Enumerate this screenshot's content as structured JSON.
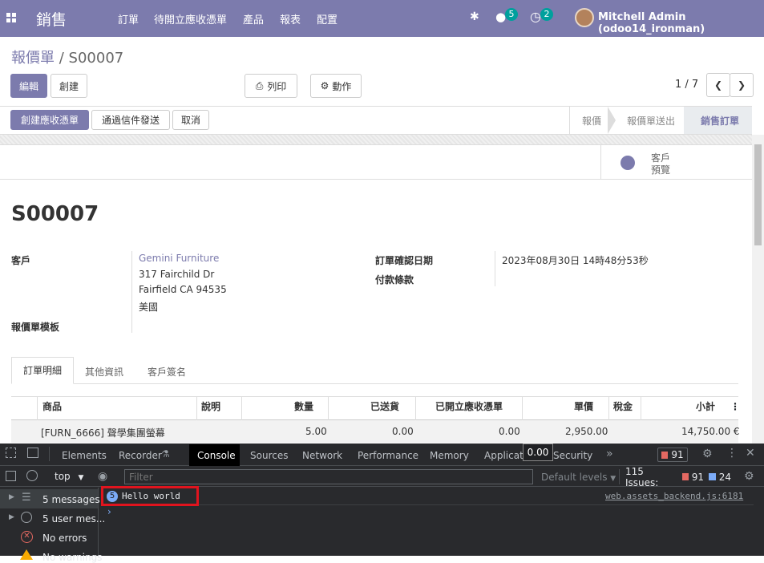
{
  "navbar": {
    "app": "銷售",
    "menu": [
      "訂單",
      "待開立應收憑單",
      "產品",
      "報表",
      "配置"
    ],
    "chat_count": "5",
    "activity_count": "2",
    "user": "Mitchell Admin (odoo14_ironman)"
  },
  "breadcrumb": {
    "parent": "報價單",
    "sep": "/",
    "current": "S00007"
  },
  "control": {
    "edit": "編輯",
    "create": "創建",
    "print": "列印",
    "action": "動作",
    "pager": "1 / 7"
  },
  "actions": {
    "invoice": "創建應收憑單",
    "email": "通過信件發送",
    "cancel": "取消"
  },
  "statusbar": [
    "報價",
    "報價單送出",
    "銷售訂單"
  ],
  "smart": {
    "line1": "客戶",
    "line2": "預覽"
  },
  "record": {
    "name": "S00007",
    "customer_label": "客戶",
    "customer_name": "Gemini Furniture",
    "addr1": "317 Fairchild Dr",
    "addr2": "Fairfield CA 94535",
    "addr3": "美國",
    "template_label": "報價單模板",
    "confirm_label": "訂單確認日期",
    "confirm_value": "2023年08月30日 14時48分53秒",
    "terms_label": "付款條款"
  },
  "tabs": [
    "訂單明細",
    "其他資訊",
    "客戶簽名"
  ],
  "table": {
    "headers": [
      "商品",
      "說明",
      "數量",
      "已送貨",
      "已開立應收憑單",
      "單價",
      "稅金",
      "小計"
    ],
    "row": [
      "[FURN_6666] 聲學集團螢幕",
      "",
      "5.00",
      "0.00",
      "0.00",
      "2,950.00",
      "",
      "14,750.00 €"
    ]
  },
  "tooltip": "0.00",
  "devtools": {
    "tabs": [
      "Elements",
      "Recorder",
      "Console",
      "Sources",
      "Network",
      "Performance",
      "Memory",
      "Application",
      "Security"
    ],
    "error_count": "91",
    "context": "top",
    "filter_placeholder": "Filter",
    "levels": "Default levels",
    "issues_label": "115 Issues:",
    "issues_err": "91",
    "issues_info": "24",
    "sidebar": [
      "5 messages",
      "5 user mes...",
      "No errors",
      "No warnings"
    ],
    "msg_count": "5",
    "msg_text": "Hello world",
    "msg_source": "web.assets_backend.js:6181"
  }
}
